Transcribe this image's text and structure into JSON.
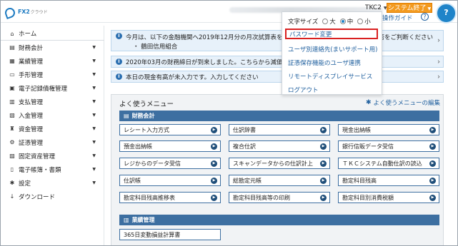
{
  "header": {
    "logo_name": "FX2",
    "logo_sub": "クラウド",
    "user_code": "TKC2",
    "exit_label": "システム終了",
    "help_avatar": "?"
  },
  "menu_dropdown": {
    "font_size_label": "文字サイズ",
    "font_options": [
      "大",
      "中",
      "小"
    ],
    "font_selected": "中",
    "operation_guide": "操作ガイド",
    "items": [
      "パスワード変更",
      "ユーザ別連絡先(まいサポート用)",
      "証憑保存機能のユーザ連携",
      "リモートディスプレイサービス",
      "ログアウト"
    ]
  },
  "sidebar": {
    "items": [
      {
        "icon": "home-icon",
        "glyph": "⌂",
        "label": "ホーム"
      },
      {
        "icon": "ledger-icon",
        "glyph": "▤",
        "label": "財務会計"
      },
      {
        "icon": "business-icon",
        "glyph": "▦",
        "label": "業績管理"
      },
      {
        "icon": "bill-icon",
        "glyph": "▭",
        "label": "手形管理"
      },
      {
        "icon": "ecredit-icon",
        "glyph": "▣",
        "label": "電子記録債権管理"
      },
      {
        "icon": "payment-icon",
        "glyph": "▥",
        "label": "支払管理"
      },
      {
        "icon": "deposit-icon",
        "glyph": "▧",
        "label": "入金管理"
      },
      {
        "icon": "fund-icon",
        "glyph": "♜",
        "label": "資金管理"
      },
      {
        "icon": "voucher-icon",
        "glyph": "⚙",
        "label": "証憑管理"
      },
      {
        "icon": "asset-icon",
        "glyph": "▨",
        "label": "固定資産管理"
      },
      {
        "icon": "ebook-icon",
        "glyph": "▯",
        "label": "電子帳簿・書類"
      },
      {
        "icon": "settings-icon",
        "glyph": "✱",
        "label": "設定"
      },
      {
        "icon": "download-icon",
        "glyph": "↓",
        "label": "ダウンロード"
      }
    ]
  },
  "notices": [
    {
      "line1": "今月は、以下の金融機関へ2019年12月分の月次試算表を提供",
      "line2": "・ 鶴田信用組合",
      "tail": "否をご判断ください"
    },
    {
      "line1": "2020年03月の財務締日が到来しました。こちらから減価償却仕"
    },
    {
      "line1": "本日の現金有高が未入力です。入力してください"
    }
  ],
  "favorites": {
    "title": "よく使うメニュー",
    "edit_label": "よく使うメニューの編集",
    "sections": [
      {
        "name": "財務会計",
        "buttons": [
          "レシート入力方式",
          "仕訳辞書",
          "現金出納帳",
          "預金出納帳",
          "複合仕訳",
          "銀行信販データ受信",
          "レジからのデータ受信",
          "スキャンデータからの仕訳計上",
          "ＴＫＣシステム自動仕訳の読込",
          "仕訳帳",
          "総勘定元帳",
          "勘定科目残高",
          "勘定科目残高推移表",
          "勘定科目残高等の印刷",
          "勘定科目別消費税額"
        ]
      },
      {
        "name": "業績管理",
        "buttons": [
          "365日変動損益計算書"
        ]
      }
    ]
  }
}
